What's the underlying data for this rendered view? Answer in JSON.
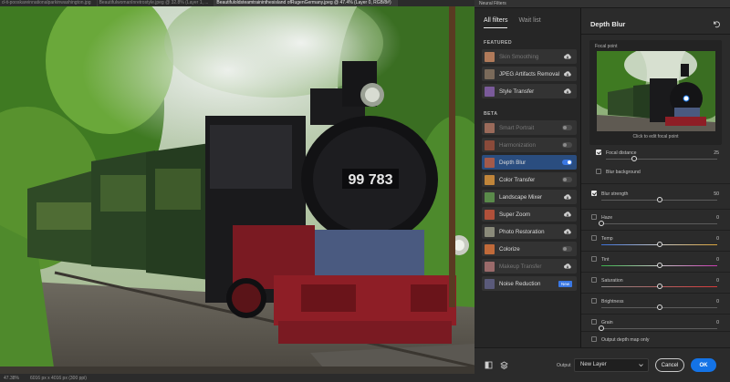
{
  "document": {
    "tabs": [
      {
        "label": "d-it-pooskareinnationalparkinwashington.jpg",
        "active": false
      },
      {
        "label": "BeautifulwomanInretrostyle.jpeg @ 32.8% (Layer 1, ...",
        "active": false
      },
      {
        "label": "Beautifuloldsteamtraininthesisland ofRugenGermany.jpeg @ 47.4% (Layer 0, RGB/8#)",
        "active": true
      }
    ],
    "status": {
      "zoom": "47.38%",
      "size": "6016 px x 4016 px (300 ppi)"
    }
  },
  "panel": {
    "title": "Neural Filters",
    "tabs": [
      {
        "label": "All filters",
        "active": true
      },
      {
        "label": "Wait list",
        "active": false
      }
    ],
    "featured_label": "FEATURED",
    "beta_label": "BETA",
    "featured": [
      {
        "label": "Skin Smoothing",
        "control": "cloud",
        "disabled": true,
        "thumb": "#b07a5a"
      },
      {
        "label": "JPEG Artifacts Removal",
        "control": "cloud",
        "disabled": false,
        "thumb": "#7a6a5a"
      },
      {
        "label": "Style Transfer",
        "control": "cloud",
        "disabled": false,
        "thumb": "#7a5a9a"
      }
    ],
    "beta": [
      {
        "label": "Smart Portrait",
        "control": "toggle",
        "disabled": true,
        "on": false,
        "thumb": "#9a6a5a"
      },
      {
        "label": "Harmonization",
        "control": "toggle",
        "disabled": true,
        "on": false,
        "thumb": "#8a4a3a"
      },
      {
        "label": "Depth Blur",
        "control": "toggle",
        "disabled": false,
        "on": true,
        "selected": true,
        "thumb": "#a45a4a"
      },
      {
        "label": "Color Transfer",
        "control": "toggle",
        "disabled": false,
        "on": false,
        "thumb": "#c0853a"
      },
      {
        "label": "Landscape Mixer",
        "control": "cloud",
        "disabled": false,
        "thumb": "#5a8a4a"
      },
      {
        "label": "Super Zoom",
        "control": "cloud",
        "disabled": false,
        "thumb": "#b0503a"
      },
      {
        "label": "Photo Restoration",
        "control": "cloud",
        "disabled": false,
        "thumb": "#8a8a7a"
      },
      {
        "label": "Colorize",
        "control": "toggle",
        "disabled": false,
        "on": false,
        "thumb": "#c06a3a"
      },
      {
        "label": "Makeup Transfer",
        "control": "cloud",
        "disabled": true,
        "thumb": "#9a6a6a"
      },
      {
        "label": "Noise Reduction",
        "control": "badge",
        "badge": "New",
        "disabled": false,
        "thumb": "#5a5a7a"
      }
    ]
  },
  "depth_blur": {
    "title": "Depth Blur",
    "focal_point_label": "Focal point",
    "focal_caption": "Click to edit focal point",
    "focal_distance": {
      "label": "Focal distance",
      "value": "25",
      "checked": true,
      "fraction": 0.25
    },
    "blur_background": {
      "label": "Blur background",
      "checked": false
    },
    "blur_strength": {
      "label": "Blur strength",
      "value": "50",
      "checked": true,
      "fraction": 0.5
    },
    "sliders": [
      {
        "label": "Haze",
        "value": "0",
        "fraction": 0.0,
        "track": "#5c5c5c"
      },
      {
        "label": "Temp",
        "value": "0",
        "fraction": 0.5,
        "track": "linear-gradient(90deg,#3a6fd8,#c8c8c8 50%,#d8a23a)"
      },
      {
        "label": "Tint",
        "value": "0",
        "fraction": 0.5,
        "track": "linear-gradient(90deg,#3ab04a,#c8c8c8 50%,#c83ab0)"
      },
      {
        "label": "Saturation",
        "value": "0",
        "fraction": 0.5,
        "track": "linear-gradient(90deg,#8a8a8a,#d83a3a)"
      },
      {
        "label": "Brightness",
        "value": "0",
        "fraction": 0.5,
        "track": "#5c5c5c"
      },
      {
        "label": "Grain",
        "value": "0",
        "fraction": 0.0,
        "track": "#5c5c5c"
      }
    ],
    "output_depth_map": {
      "label": "Output depth map only",
      "checked": false
    }
  },
  "footer": {
    "output_label": "Output",
    "output_value": "New Layer",
    "cancel_label": "Cancel",
    "ok_label": "OK"
  },
  "photo": {
    "plate_text": "99 783"
  }
}
